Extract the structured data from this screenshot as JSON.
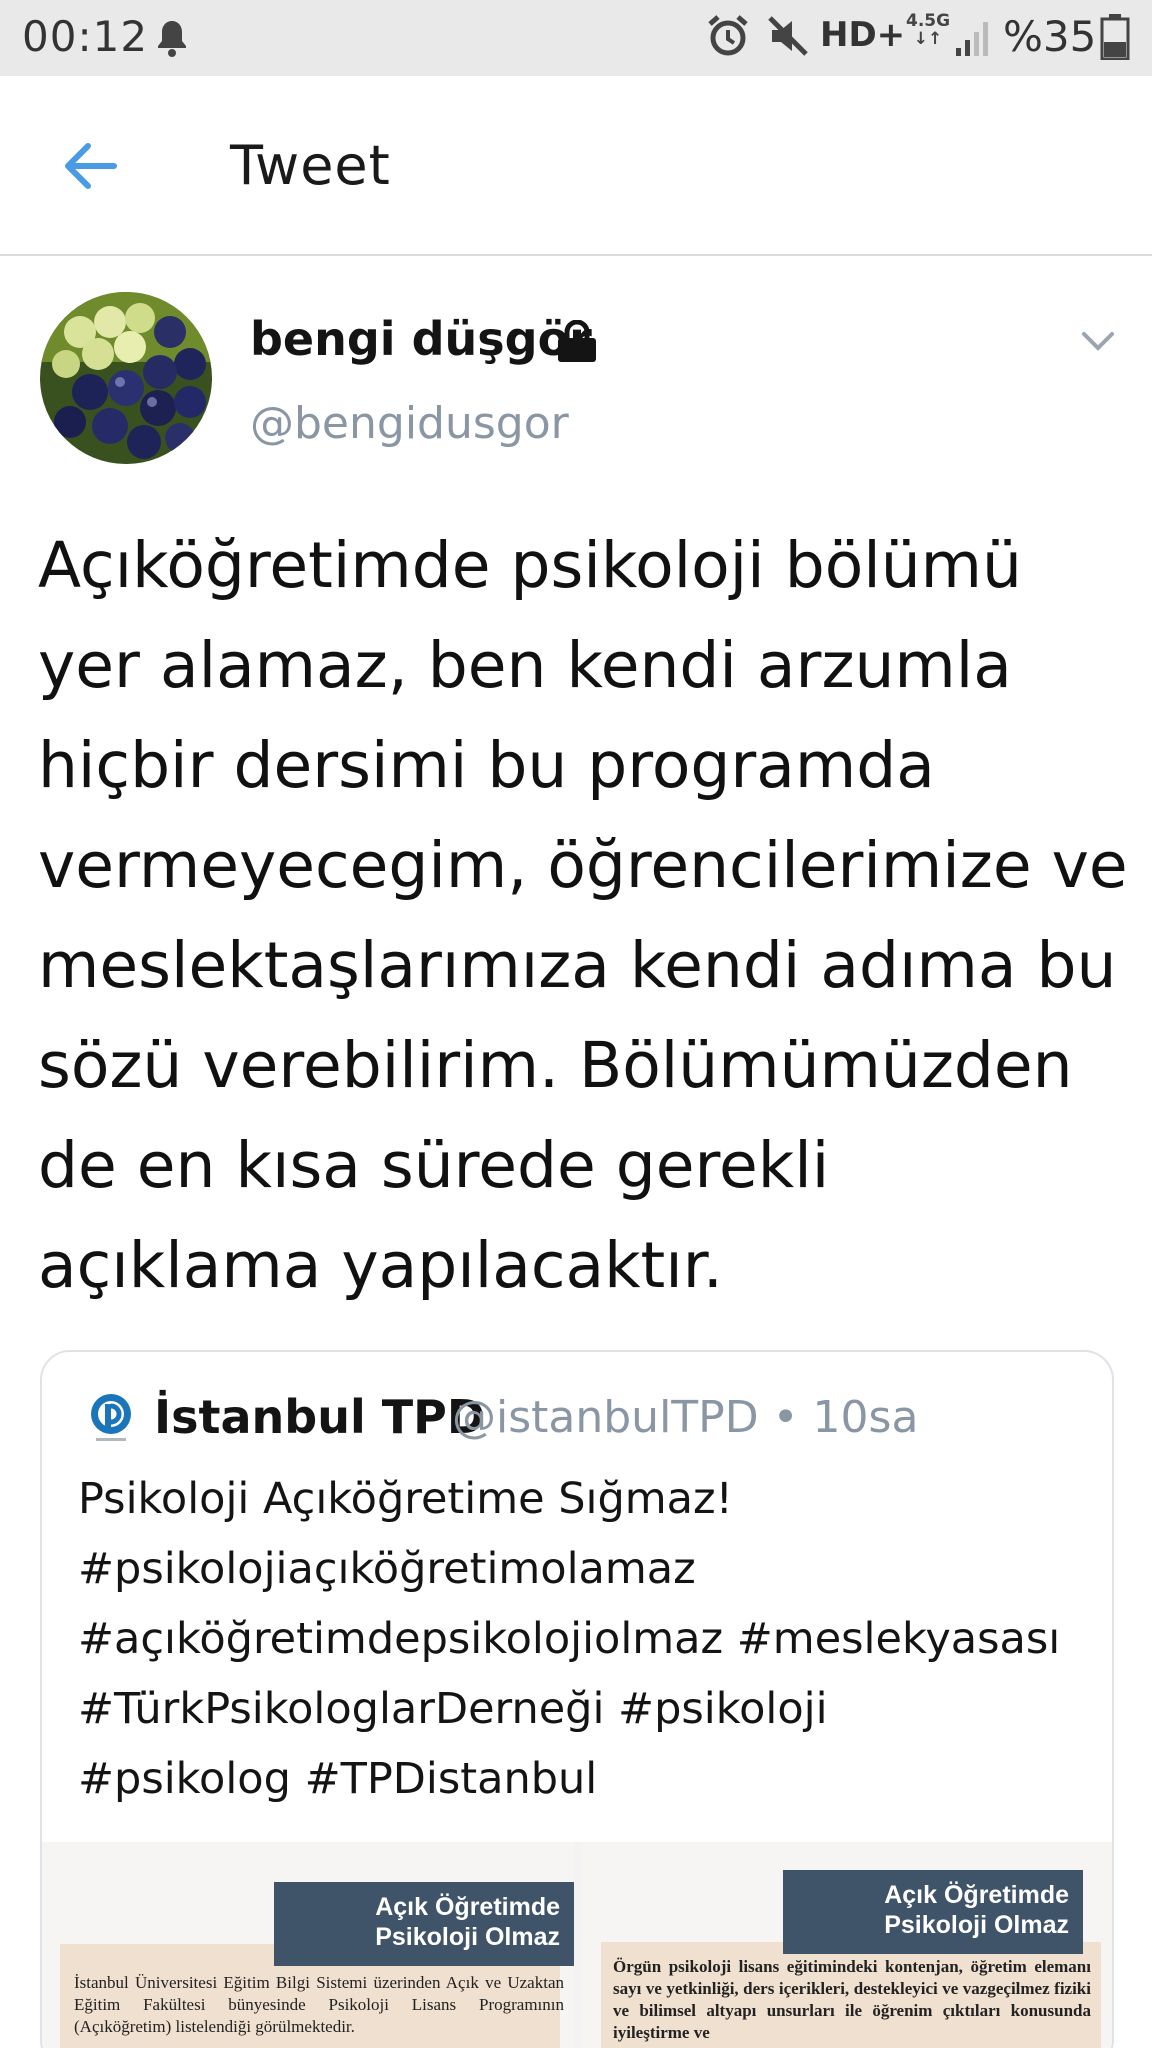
{
  "status_bar": {
    "time": "00:12",
    "network_type": "HD+",
    "network_gen": "4.5G",
    "battery": "%35",
    "icons": [
      "bell-icon",
      "alarm-icon",
      "mute-icon",
      "signal-icon",
      "battery-icon"
    ]
  },
  "header": {
    "title": "Tweet",
    "back_icon": "arrow-left-icon",
    "accent_color": "#4a9be6"
  },
  "tweet": {
    "author_name": "bengi düşgör",
    "author_handle": "@bengidusgor",
    "protected": true,
    "text": "Açıköğretimde psikoloji bölümü yer alamaz, ben kendi arzumla hiçbir dersimi bu programda vermeyecegim, öğrencilerimize ve meslektaşlarımıza kendi adıma bu sözü verebilirim. Bölümümüzden de en kısa sürede gerekli açıklama yapılacaktır."
  },
  "quoted_tweet": {
    "author_name": "İstanbul TPD",
    "author_handle": "@istanbulTPD",
    "separator": "•",
    "time": "10sa",
    "lines": [
      "Psikoloji Açıköğretime Sığmaz!",
      "#psikolojiaçıköğretimolamaz",
      "#açıköğretimdepsikolojiolmaz #meslekyasası",
      "#TürkPsikologlarDerneği #psikoloji",
      "#psikolog #TPDistanbul"
    ],
    "media": [
      {
        "banner": "Açık Öğretimde Psikoloji Olmaz",
        "text": "İstanbul Üniversitesi Eğitim Bilgi Sistemi üzerinden Açık ve Uzaktan Eğitim Fakültesi bünyesinde Psikoloji Lisans Programının (Açıköğretim) listelendiği görülmektedir."
      },
      {
        "banner": "Açık Öğretimde Psikoloji Olmaz",
        "text": "Örgün psikoloji lisans eğitimindeki kontenjan, öğretim elemanı sayı ve yetkinliği, ders içerikleri, destekleyici ve vazgeçilmez fiziki ve bilimsel altyapı unsurları ile öğrenim çıktıları konusunda iyileştirme ve"
      }
    ]
  }
}
